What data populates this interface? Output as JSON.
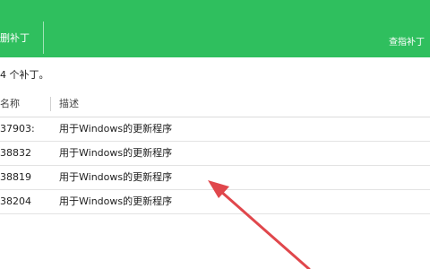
{
  "header": {
    "active_tab": "删补丁",
    "link": "查指补丁"
  },
  "summary": "4 个补丁。",
  "table": {
    "columns": [
      "名称",
      "描述"
    ],
    "rows": [
      {
        "id": "37903:",
        "desc": "用于Windows的更新程序"
      },
      {
        "id": "38832",
        "desc": "用于Windows的更新程序"
      },
      {
        "id": "38819",
        "desc": "用于Windows的更新程序"
      },
      {
        "id": "38204",
        "desc": "用于Windows的更新程序"
      }
    ]
  },
  "annotation": {
    "arrow_color": "#e0474c"
  },
  "colors": {
    "header_green": "#2fbf5e"
  }
}
